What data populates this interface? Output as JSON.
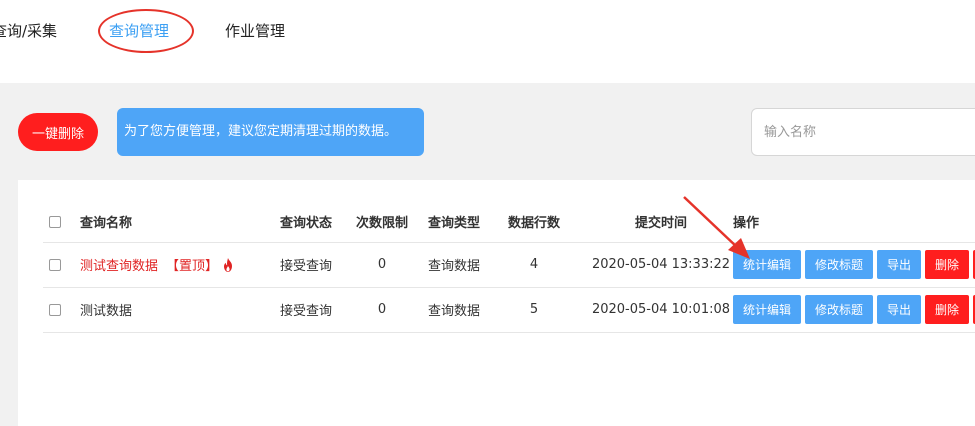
{
  "nav": {
    "items": [
      {
        "label": "查询/采集"
      },
      {
        "label": "查询管理"
      },
      {
        "label": "作业管理"
      }
    ]
  },
  "toolbar": {
    "delete_all_label": "一键删除",
    "tip_text": "为了您方便管理，建议您定期清理过期的数据。",
    "search_placeholder": "输入名称"
  },
  "table": {
    "headers": {
      "name": "查询名称",
      "status": "查询状态",
      "limit": "次数限制",
      "type": "查询类型",
      "rows": "数据行数",
      "time": "提交时间",
      "ops": "操作"
    },
    "rows": [
      {
        "name": "测试查询数据",
        "pin_tag": "【置顶】",
        "pinned": true,
        "status": "接受查询",
        "limit": "0",
        "type": "查询数据",
        "rows": "4",
        "time": "2020-05-04 13:33:22"
      },
      {
        "name": "测试数据",
        "pinned": false,
        "status": "接受查询",
        "limit": "0",
        "type": "查询数据",
        "rows": "5",
        "time": "2020-05-04 10:01:08"
      }
    ],
    "actions": {
      "stats_edit": "统计编辑",
      "edit_title": "修改标题",
      "export": "导出",
      "delete": "删除"
    }
  },
  "colors": {
    "primary_blue": "#4ea5f7",
    "danger_red": "#ff1e1e",
    "pinned_red": "#e02424",
    "annotation_red": "#e5332a"
  }
}
